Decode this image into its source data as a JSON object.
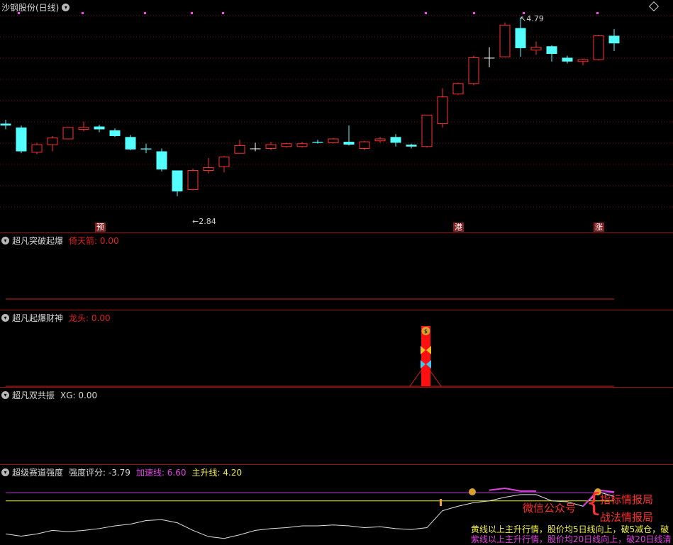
{
  "main": {
    "title": "沙钢股份(日线)",
    "high_label": "4.79",
    "low_label": "2.84",
    "signal_tags": [
      "预",
      "港",
      "涨"
    ]
  },
  "panel1": {
    "title": "超凡突破起爆",
    "label_name": "倚天箭",
    "label_value": ": 0.00"
  },
  "panel2": {
    "title": "超凡起爆财神",
    "label_name": "龙头",
    "label_value": ": 0.00"
  },
  "panel3": {
    "title": "超凡双共振",
    "label": "XG: 0.00"
  },
  "panel4": {
    "title": "超级赛道强度",
    "score_label": "强度评分: -3.79",
    "accel_label": "加速线: 6.60",
    "main_label": "主升线: 4.20"
  },
  "watermark": {
    "line1": "微信公众号",
    "line2a": "指标情报局",
    "line2b": "战法情报局",
    "bottom1": "黄线以上主升行情，股价均5日线向上，破5减仓，破",
    "bottom2": "紫线以上主升行情，股价均20日线向上，破20日线清"
  },
  "colors": {
    "up": "#ff3030",
    "down": "#54ffff",
    "grid": "#7a1010",
    "white_line": "#e0e0e0",
    "yellow_line": "#f0f040",
    "magenta_line": "#e040e0"
  },
  "chart_data": {
    "type": "candlestick",
    "price_range": [
      2.6,
      4.9
    ],
    "candles": [
      {
        "o": 3.68,
        "c": 3.66,
        "h": 3.72,
        "l": 3.62
      },
      {
        "o": 3.64,
        "c": 3.39,
        "h": 3.66,
        "l": 3.37
      },
      {
        "o": 3.38,
        "c": 3.46,
        "h": 3.48,
        "l": 3.36
      },
      {
        "o": 3.46,
        "c": 3.53,
        "h": 3.55,
        "l": 3.39
      },
      {
        "o": 3.52,
        "c": 3.64,
        "h": 3.64,
        "l": 3.52
      },
      {
        "o": 3.62,
        "c": 3.64,
        "h": 3.7,
        "l": 3.6
      },
      {
        "o": 3.65,
        "c": 3.62,
        "h": 3.67,
        "l": 3.59
      },
      {
        "o": 3.61,
        "c": 3.55,
        "h": 3.63,
        "l": 3.54
      },
      {
        "o": 3.54,
        "c": 3.41,
        "h": 3.56,
        "l": 3.4
      },
      {
        "o": 3.42,
        "c": 3.41,
        "h": 3.47,
        "l": 3.37
      },
      {
        "o": 3.39,
        "c": 3.2,
        "h": 3.42,
        "l": 3.18
      },
      {
        "o": 3.19,
        "c": 2.97,
        "h": 3.19,
        "l": 2.92
      },
      {
        "o": 2.99,
        "c": 3.19,
        "h": 3.21,
        "l": 2.98
      },
      {
        "o": 3.19,
        "c": 3.22,
        "h": 3.32,
        "l": 3.16
      },
      {
        "o": 3.23,
        "c": 3.33,
        "h": 3.34,
        "l": 3.17
      },
      {
        "o": 3.37,
        "c": 3.45,
        "h": 3.51,
        "l": 3.37
      },
      {
        "o": 3.42,
        "c": 3.42,
        "h": 3.48,
        "l": 3.39
      },
      {
        "o": 3.42,
        "c": 3.46,
        "h": 3.49,
        "l": 3.4
      },
      {
        "o": 3.44,
        "c": 3.47,
        "h": 3.48,
        "l": 3.43
      },
      {
        "o": 3.44,
        "c": 3.47,
        "h": 3.49,
        "l": 3.43
      },
      {
        "o": 3.49,
        "c": 3.48,
        "h": 3.51,
        "l": 3.47
      },
      {
        "o": 3.48,
        "c": 3.52,
        "h": 3.53,
        "l": 3.47
      },
      {
        "o": 3.49,
        "c": 3.46,
        "h": 3.66,
        "l": 3.45
      },
      {
        "o": 3.42,
        "c": 3.49,
        "h": 3.5,
        "l": 3.4
      },
      {
        "o": 3.5,
        "c": 3.52,
        "h": 3.54,
        "l": 3.48
      },
      {
        "o": 3.54,
        "c": 3.48,
        "h": 3.57,
        "l": 3.44
      },
      {
        "o": 3.46,
        "c": 3.44,
        "h": 3.47,
        "l": 3.42
      },
      {
        "o": 3.44,
        "c": 3.77,
        "h": 3.77,
        "l": 3.43
      },
      {
        "o": 3.68,
        "c": 3.96,
        "h": 4.05,
        "l": 3.64
      },
      {
        "o": 3.99,
        "c": 4.1,
        "h": 4.11,
        "l": 3.98
      },
      {
        "o": 4.1,
        "c": 4.37,
        "h": 4.39,
        "l": 4.08
      },
      {
        "o": 4.37,
        "c": 4.37,
        "h": 4.48,
        "l": 4.27
      },
      {
        "o": 4.38,
        "c": 4.71,
        "h": 4.74,
        "l": 4.38
      },
      {
        "o": 4.68,
        "c": 4.47,
        "h": 4.79,
        "l": 4.38
      },
      {
        "o": 4.45,
        "c": 4.48,
        "h": 4.54,
        "l": 4.4
      },
      {
        "o": 4.49,
        "c": 4.41,
        "h": 4.5,
        "l": 4.33
      },
      {
        "o": 4.37,
        "c": 4.33,
        "h": 4.39,
        "l": 4.31
      },
      {
        "o": 4.33,
        "c": 4.35,
        "h": 4.36,
        "l": 4.29
      },
      {
        "o": 4.35,
        "c": 4.6,
        "h": 4.61,
        "l": 4.34
      },
      {
        "o": 4.6,
        "c": 4.52,
        "h": 4.67,
        "l": 4.44
      }
    ],
    "strength_white": [
      -8,
      -8.5,
      -8,
      -7.2,
      -7.5,
      -7.2,
      -6.8,
      -6.2,
      -5.8,
      -5,
      -4.8,
      -5.5,
      -7.2,
      -8.6,
      -9,
      -8.2,
      -7.2,
      -6.8,
      -6.6,
      -6.2,
      -6.2,
      -6,
      -6.2,
      -6.6,
      -6.4,
      -6.8,
      -7,
      -6.6,
      -2.8,
      -1.8,
      -1,
      -0.6,
      0.2,
      0.8,
      0.8,
      -0.6,
      -0.8,
      -1.8,
      1.4,
      0.4
    ],
    "strength_magenta": [
      null,
      null,
      null,
      null,
      null,
      null,
      null,
      null,
      null,
      null,
      null,
      null,
      null,
      null,
      null,
      null,
      null,
      null,
      null,
      null,
      null,
      null,
      null,
      null,
      null,
      null,
      null,
      null,
      null,
      null,
      null,
      1.8,
      2.2,
      1.6,
      1.6,
      null,
      null,
      -1.8,
      1.8,
      1.4
    ]
  }
}
